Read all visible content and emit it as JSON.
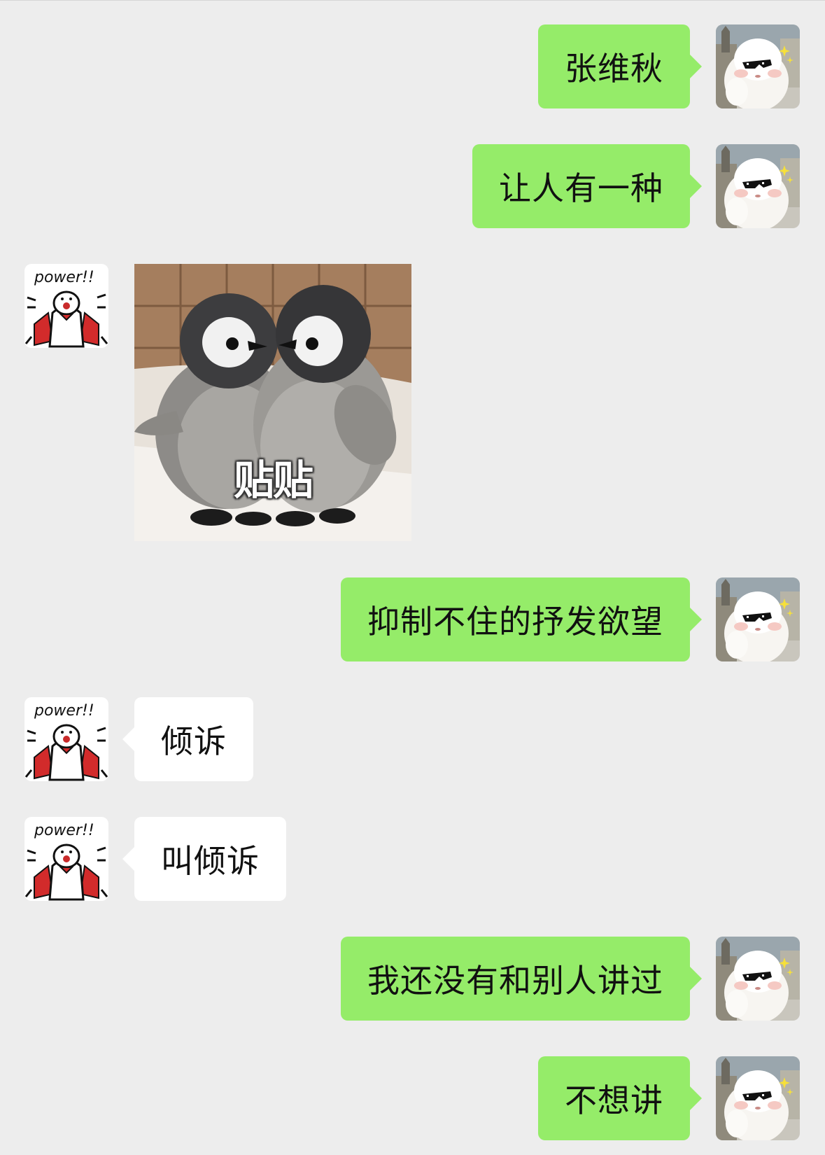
{
  "chat": {
    "messages": [
      {
        "sender": "me",
        "type": "text",
        "text": "张维秋"
      },
      {
        "sender": "me",
        "type": "text",
        "text": "让人有一种"
      },
      {
        "sender": "other",
        "type": "sticker",
        "caption": "贴贴",
        "icon": "penguin-chicks-sticker"
      },
      {
        "sender": "me",
        "type": "text",
        "text": "抑制不住的抒发欲望"
      },
      {
        "sender": "other",
        "type": "text",
        "text": "倾诉"
      },
      {
        "sender": "other",
        "type": "text",
        "text": "叫倾诉"
      },
      {
        "sender": "me",
        "type": "text",
        "text": "我还没有和别人讲过"
      },
      {
        "sender": "me",
        "type": "text",
        "text": "不想讲"
      }
    ]
  },
  "avatars": {
    "me": {
      "icon": "alpaca-sunglasses-avatar"
    },
    "other": {
      "icon": "power-cartoon-avatar",
      "text": "power!!"
    }
  },
  "colors": {
    "background": "#ededed",
    "my_bubble": "#95ec69",
    "other_bubble": "#ffffff",
    "text": "#111111"
  }
}
